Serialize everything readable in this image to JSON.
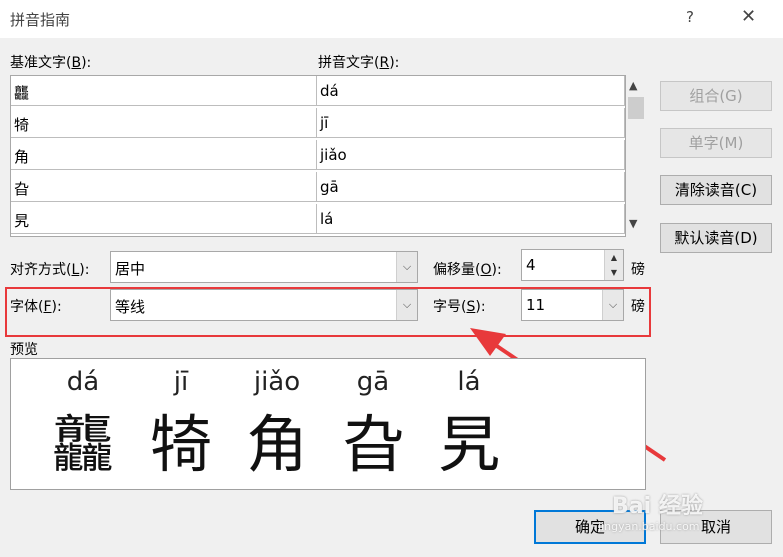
{
  "window": {
    "title": "拼音指南",
    "help_label": "?",
    "close_label": "✕"
  },
  "headers": {
    "base_text_prefix": "基准文字(",
    "base_text_key": "B",
    "base_text_suffix": "):",
    "pinyin_text_prefix": "拼音文字(",
    "pinyin_text_key": "R",
    "pinyin_text_suffix": "):"
  },
  "rows": [
    {
      "base": "龘",
      "pinyin": "dá"
    },
    {
      "base": "犄",
      "pinyin": "jī"
    },
    {
      "base": "角",
      "pinyin": "jiǎo"
    },
    {
      "base": "旮",
      "pinyin": "gā"
    },
    {
      "base": "旯",
      "pinyin": "lá"
    }
  ],
  "side_buttons": [
    {
      "label": "组合(G)",
      "enabled": false
    },
    {
      "label": "单字(M)",
      "enabled": false
    },
    {
      "label": "清除读音(C)",
      "enabled": true
    },
    {
      "label": "默认读音(D)",
      "enabled": true
    }
  ],
  "alignment": {
    "label_prefix": "对齐方式(",
    "label_key": "L",
    "label_suffix": "):",
    "value": "居中"
  },
  "offset": {
    "label_prefix": "偏移量(",
    "label_key": "O",
    "label_suffix": "):",
    "value": "4",
    "unit": "磅"
  },
  "font": {
    "label_prefix": "字体(",
    "label_key": "F",
    "label_suffix": "):",
    "value": "等线"
  },
  "size": {
    "label_prefix": "字号(",
    "label_key": "S",
    "label_suffix": "):",
    "value": "11",
    "unit": "磅"
  },
  "preview": {
    "label": "预览",
    "items": [
      {
        "pinyin": "dá",
        "char": "龘"
      },
      {
        "pinyin": "jī",
        "char": "犄"
      },
      {
        "pinyin": "jiǎo",
        "char": "角"
      },
      {
        "pinyin": "gā",
        "char": "旮"
      },
      {
        "pinyin": "lá",
        "char": "旯"
      }
    ]
  },
  "footer": {
    "ok_label": "确定",
    "cancel_label": "取消"
  },
  "watermark": {
    "brand": "Bai 经验",
    "url": "jingyan.baidu.com"
  },
  "colors": {
    "highlight": "#e8393b",
    "default_button_border": "#0078d7"
  }
}
